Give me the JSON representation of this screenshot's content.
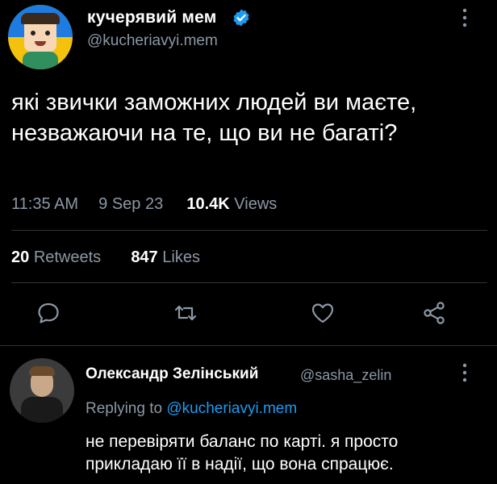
{
  "author": {
    "name": "кучерявий мем",
    "handle": "@kucheriavyi.mem",
    "verified": true
  },
  "tweet": {
    "text": "які звички заможних людей ви маєте, незважаючи на те, що ви не багаті?",
    "time": "11:35 AM",
    "date": "9 Sep 23",
    "views_count": "10.4K",
    "views_label": "Views",
    "retweets_count": "20",
    "retweets_label": "Retweets",
    "likes_count": "847",
    "likes_label": "Likes"
  },
  "actions": {
    "reply_icon": "reply-icon",
    "retweet_icon": "retweet-icon",
    "like_icon": "heart-icon",
    "share_icon": "share-icon"
  },
  "reply": {
    "name": "Олександр Зелінський",
    "handle": "@sasha_zelin",
    "replying_prefix": "Replying to",
    "replying_handle": "@kucheriavyi.mem",
    "text": "не перевіряти баланс по карті. я просто прикладаю її в надії, що вона спрацює."
  },
  "colors": {
    "background": "#000000",
    "primary_text": "#e7e9ea",
    "secondary_text": "#8b98a5",
    "accent": "#1d9bf0",
    "divider": "#2f3336"
  }
}
